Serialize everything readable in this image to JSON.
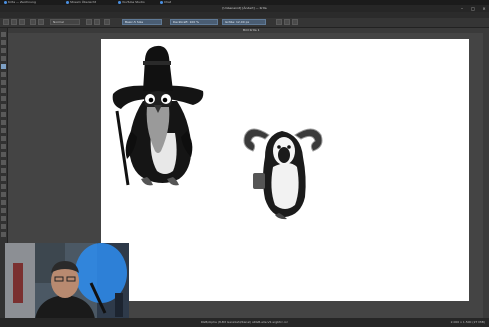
{
  "browser": {
    "tabs": [
      {
        "label": "Krita — Zeichnung"
      },
      {
        "label": "Stream Übersicht"
      },
      {
        "label": "YouTube Studio"
      },
      {
        "label": "Chat"
      }
    ]
  },
  "app": {
    "title": "[Unbenannt] [Ändert] — Krita",
    "canvas_tab": "Bild Krita 1"
  },
  "menubar": {
    "items": [
      "Datei",
      "Bearbeiten",
      "Ansicht",
      "Bild",
      "Ebene",
      "Auswahl",
      "Filter",
      "Werkzeuge",
      "Einstellungen",
      "Fenster",
      "Hilfe"
    ]
  },
  "toolbar": {
    "blend_mode": "Normal",
    "brush_preset": "Basic-5 Size",
    "opacity": "Deckkraft: 100 %",
    "size": "Größe: 12,00 px"
  },
  "statusbar": {
    "text": "RGB/Alpha (8-Bit Ganzzahl/Kanal) sRGB-elle-V2-srgbtrc.icc",
    "right": "2.000 x 1.500 (27 MiB)"
  },
  "colors": {
    "accent": "#4a5d73",
    "canvas": "#ffffff",
    "workspace": "#444444"
  },
  "icons": [
    "close-icon",
    "minimize-icon",
    "maximize-icon",
    "brush-icon"
  ]
}
